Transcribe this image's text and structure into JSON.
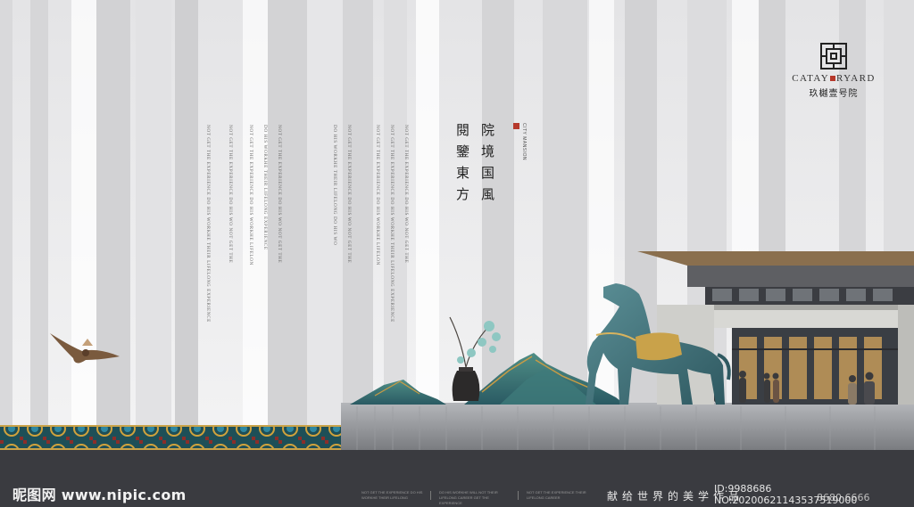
{
  "brand": {
    "name_en_left": "CATAY",
    "name_en_right": "RYARD",
    "name_cn": "玖樾壹号院"
  },
  "headline": {
    "col1": "院境国風",
    "col2": "閱鑒東方",
    "badge": "CITY MANSION"
  },
  "body_columns": [
    "NOT GET THE EXPERIENCE DO HIS WORKHE THEIR LIFELONG EXPERIENCE",
    "NOT GET THE EXPERIENCE DO HIS WO NOT GET THE",
    "NOT GET THE EXPERIENCE DO HIS WORKHE LIFELON",
    "DO HIS WORKHE THEIR LIFELONG EXPERIENCE",
    "NOT GET THE EXPERIENCE DO HIS WO NOT GET THE",
    "DO HIS WORKHE THEIR LIFELONG DO HIS WO",
    "NOT GET THE EXPERIENCE DO HIS WO NOT GET THE",
    "NOT GET THE EXPERIENCE DO HIS WORKHE LIFELON",
    "NOT GET THE EXPERIENCE DO HIS WORKHE THEIR LIFELONG EXPERIENCE",
    "NOT GET THE EXPERIENCE DO HIS WO NOT GET THE"
  ],
  "footer": {
    "slogan": "献给世界的美学作品",
    "notes": [
      "NOT GET THE EXPERIENCE DO HIS WORKHE THEIR LIFELONG",
      "DO HIS WORKHE WILL NOT THEIR LIFELONG CAREER GET THE EXPERIENCE",
      "NOT GET THE EXPERIENCE THEIR LIFELONG CAREER"
    ],
    "phone": "8680 6666"
  },
  "watermark": {
    "site": "昵图网 www.nipic.com",
    "id": "ID:9988686 NO:20200621143537519000"
  },
  "colors": {
    "seal_red": "#b6392c",
    "footer_bg": "#3a3b40",
    "horse_teal": "#3f6f78"
  },
  "icons": [
    "fretwork-logo-icon",
    "bird-illustration",
    "horse-sculpture",
    "vase-with-orchid",
    "jade-mountain",
    "chinese-pattern-border"
  ]
}
